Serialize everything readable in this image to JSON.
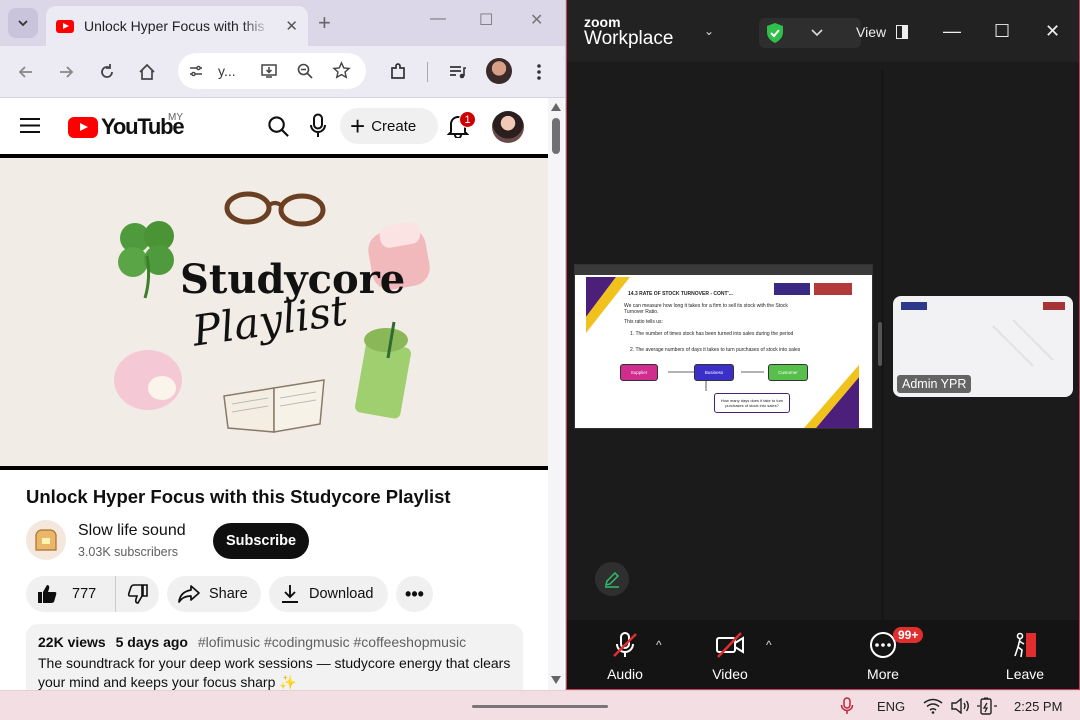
{
  "browser": {
    "tab_title": "Unlock Hyper Focus with this Studycore Playlist - YouTube",
    "omnibox_text": "y...",
    "colors": {
      "accent": "#ff0000"
    }
  },
  "youtube": {
    "logo_text": "YouTube",
    "region": "MY",
    "create_label": "Create",
    "notification_count": "1",
    "thumbnail": {
      "title_line1": "Studycore",
      "title_line2": "Playlist"
    },
    "video_title": "Unlock Hyper Focus with this Studycore Playlist",
    "channel": {
      "name": "Slow life sound",
      "subscribers": "3.03K subscribers"
    },
    "subscribe_label": "Subscribe",
    "like_count": "777",
    "share_label": "Share",
    "download_label": "Download",
    "more_label": "•••",
    "description": {
      "views": "22K views",
      "age": "5 days ago",
      "tags": "#lofimusic #codingmusic #coffeeshopmusic",
      "text": "The soundtrack for your deep work sessions — studycore energy that clears your mind and keeps your focus sharp ✨"
    }
  },
  "zoom": {
    "brand_small": "zoom",
    "brand_large": "Workplace",
    "view_label": "View",
    "participant_name": "Admin YPR",
    "slide": {
      "heading": "14.3 RATE OF STOCK TURNOVER - CONT'...",
      "line1": "We can measure how long it takes for a firm to sell its stock with the Stock Turnover Ratio.",
      "line2": "This ratio tells us:",
      "line3": "1. The number of times stock has been turned into sales during the period",
      "line4": "2. The average numbers of days it takes to turn purchases of stock into sales",
      "flow": [
        "Supplier",
        "Business",
        "Customer"
      ],
      "question": "How many days does it take to turn purchases of stock into sales?"
    },
    "controls": {
      "audio": "Audio",
      "video": "Video",
      "more": "More",
      "more_badge": "99+",
      "leave": "Leave"
    },
    "colors": {
      "leave": "#e02e2e",
      "secure": "#2fbf4a"
    }
  },
  "taskbar": {
    "language": "ENG",
    "time": "2:25 PM"
  }
}
